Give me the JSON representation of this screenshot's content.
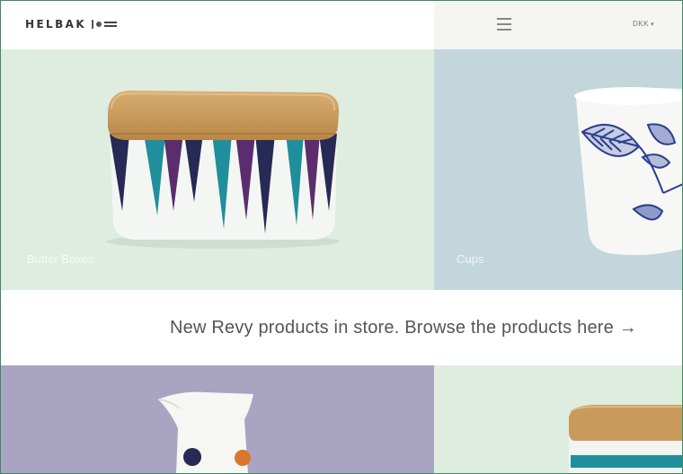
{
  "header": {
    "logo_text": "HELBAK",
    "currency": {
      "label": "DKK",
      "caret": "▾"
    }
  },
  "tiles": {
    "butter": {
      "label": "Butter Boxes"
    },
    "cups": {
      "label": "Cups"
    }
  },
  "banner": {
    "text": "New Revy products in store. Browse the products here →"
  },
  "colors": {
    "butter_bg": "#dfece0",
    "cups_bg": "#c3d6db",
    "jug_bg": "#a9a4c2",
    "jar_bg": "#dfece0",
    "border": "#3e8a63"
  },
  "icons": [
    "menu-icon",
    "logo-mark-icon",
    "arrow-right-icon"
  ]
}
